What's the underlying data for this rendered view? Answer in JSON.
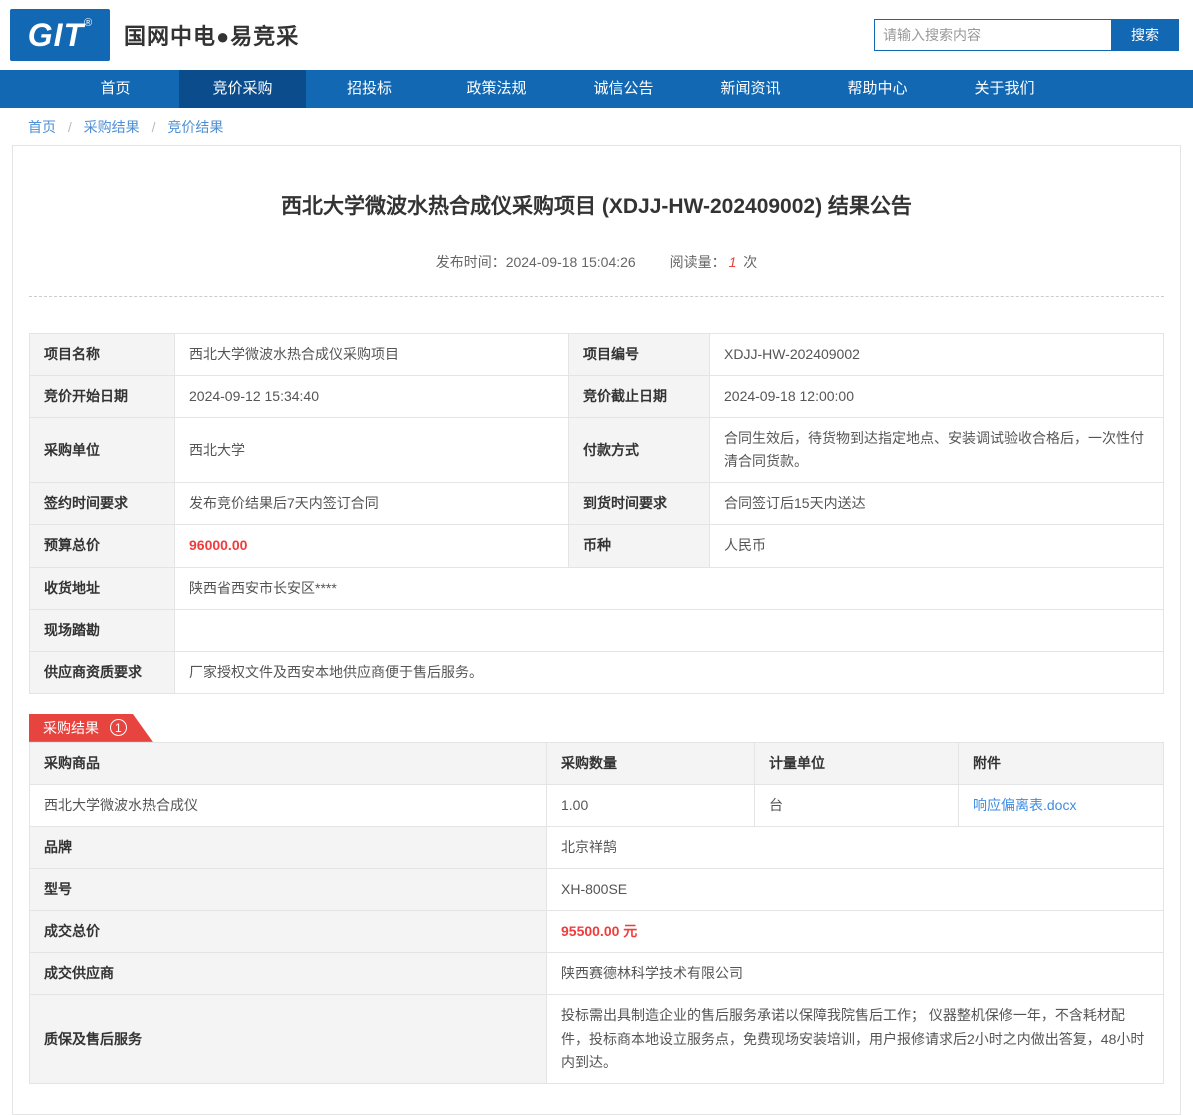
{
  "header": {
    "logo_text": "GIT",
    "logo_reg": "®",
    "site_name": "国网中电●易竞采",
    "search_placeholder": "请输入搜索内容",
    "search_button": "搜索"
  },
  "nav": {
    "items": [
      {
        "label": "首页",
        "active": false
      },
      {
        "label": "竞价采购",
        "active": true
      },
      {
        "label": "招投标",
        "active": false
      },
      {
        "label": "政策法规",
        "active": false
      },
      {
        "label": "诚信公告",
        "active": false
      },
      {
        "label": "新闻资讯",
        "active": false
      },
      {
        "label": "帮助中心",
        "active": false
      },
      {
        "label": "关于我们",
        "active": false
      }
    ]
  },
  "breadcrumb": {
    "separator": "/",
    "items": [
      {
        "label": "首页"
      },
      {
        "label": "采购结果"
      },
      {
        "label": "竞价结果"
      }
    ]
  },
  "article": {
    "title": "西北大学微波水热合成仪采购项目 (XDJJ-HW-202409002) 结果公告",
    "publish_label": "发布时间：",
    "publish_time": "2024-09-18 15:04:26",
    "views_label": "阅读量：",
    "views_count": "1",
    "views_unit": "次"
  },
  "info_table": {
    "rows": [
      {
        "l1": "项目名称",
        "v1": "西北大学微波水热合成仪采购项目",
        "l2": "项目编号",
        "v2": "XDJJ-HW-202409002"
      },
      {
        "l1": "竞价开始日期",
        "v1": "2024-09-12 15:34:40",
        "l2": "竞价截止日期",
        "v2": "2024-09-18 12:00:00"
      },
      {
        "l1": "采购单位",
        "v1": "西北大学",
        "l2": "付款方式",
        "v2": "合同生效后，待货物到达指定地点、安装调试验收合格后，一次性付清合同货款。"
      },
      {
        "l1": "签约时间要求",
        "v1": "发布竞价结果后7天内签订合同",
        "l2": "到货时间要求",
        "v2": "合同签订后15天内送达"
      },
      {
        "l1": "预算总价",
        "v1": "96000.00",
        "l2": "币种",
        "v2": "人民币"
      },
      {
        "l1": "收货地址",
        "v1": "陕西省西安市长安区****"
      },
      {
        "l1": "现场踏勘",
        "v1": ""
      },
      {
        "l1": "供应商资质要求",
        "v1": "厂家授权文件及西安本地供应商便于售后服务。"
      }
    ]
  },
  "result_section": {
    "badge_label": "采购结果",
    "badge_count": "1",
    "headers": [
      "采购商品",
      "采购数量",
      "计量单位",
      "附件"
    ],
    "product": {
      "name": "西北大学微波水热合成仪",
      "quantity": "1.00",
      "unit": "台",
      "attachment": "响应偏离表.docx"
    },
    "details": [
      {
        "label": "品牌",
        "value": "北京祥鹄"
      },
      {
        "label": "型号",
        "value": "XH-800SE"
      },
      {
        "label": "成交总价",
        "value": "95500.00 元"
      },
      {
        "label": "成交供应商",
        "value": "陕西赛德林科学技术有限公司"
      },
      {
        "label": "质保及售后服务",
        "value": "投标需出具制造企业的售后服务承诺以保障我院售后工作； 仪器整机保修一年，不含耗材配件，投标商本地设立服务点，免费现场安装培训，用户报修请求后2小时之内做出答复，48小时内到达。"
      }
    ]
  },
  "colors": {
    "nav_blue": "#1268b3",
    "nav_active_blue": "#0a4c8c",
    "ribbon_red": "#e8443f",
    "price_red": "#f03c3c",
    "link_blue": "#3f8ce0"
  }
}
